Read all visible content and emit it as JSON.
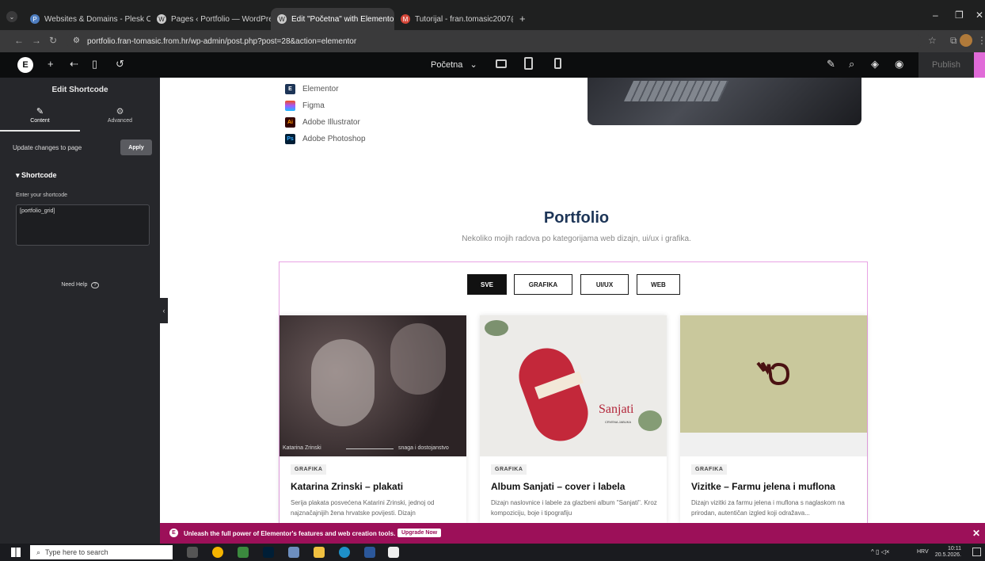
{
  "browser": {
    "tabs": [
      {
        "label": "Websites & Domains - Plesk Ob",
        "active": false
      },
      {
        "label": "Pages ‹ Portfolio — WordPress",
        "active": false
      },
      {
        "label": "Edit \"Početna\" with Elementor",
        "active": true
      },
      {
        "label": "Tutorijal - fran.tomasic2007@g",
        "active": false
      }
    ],
    "new_tab": "+",
    "url": "portfolio.fran-tomasic.from.hr/wp-admin/post.php?post=28&action=elementor"
  },
  "elementor_bar": {
    "logo": "E",
    "page_selector": "Početna",
    "publish": "Publish"
  },
  "sidebar": {
    "title": "Edit Shortcode",
    "tabs": [
      {
        "label": "Content"
      },
      {
        "label": "Advanced"
      }
    ],
    "update_text": "Update changes to page",
    "apply": "Apply",
    "section": "Shortcode",
    "field_label": "Enter your shortcode",
    "field_value": "[portfolio_grid]",
    "need_help": "Need Help"
  },
  "canvas": {
    "tools": [
      "Elementor",
      "Figma",
      "Adobe Illustrator",
      "Adobe Photoshop"
    ],
    "portfolio_title": "Portfolio",
    "portfolio_subtitle": "Nekoliko mojih radova po kategorijama web dizajn, ui/ux i grafika.",
    "filters": [
      {
        "label": "SVE",
        "active": true
      },
      {
        "label": "GRAFIKA",
        "active": false
      },
      {
        "label": "UI/UX",
        "active": false
      },
      {
        "label": "WEB",
        "active": false
      }
    ],
    "cards": [
      {
        "badge": "GRAFIKA",
        "title": "Katarina Zrinski – plakati",
        "desc": "Serija plakata posvećena Katarini Zrinski, jednoj od najznačajnijih žena hrvatske povijesti. Dizajn",
        "img_caption_left": "Katarina Zrinski",
        "img_caption_right": "snaga i dostojanstvo"
      },
      {
        "badge": "GRAFIKA",
        "title": "Album Sanjati – cover i labela",
        "desc": "Dizajn naslovnice i labele za glazbeni album \"Sanjati\". Kroz kompoziciju, boje i tipografiju",
        "img_title": "Sanjati",
        "img_subtitle": "CRVENA JABUKA"
      },
      {
        "badge": "GRAFIKA",
        "title": "Vizitke – Farmu jelena i muflona",
        "desc": "Dizajn vizitki za farmu jelena i muflona s naglaskom na prirodan, autentičan izgled koji odražava..."
      }
    ]
  },
  "upgrade_bar": {
    "text": "Unleash the full power of Elementor's features and web creation tools.",
    "button": "Upgrade Now"
  },
  "taskbar": {
    "search_placeholder": "Type here to search",
    "lang": "HRV",
    "time": "10:11",
    "date": "20.5.2026."
  },
  "colors": {
    "accent": "#9c1059",
    "heading": "#1d3557",
    "frame": "#e8a3e4"
  }
}
